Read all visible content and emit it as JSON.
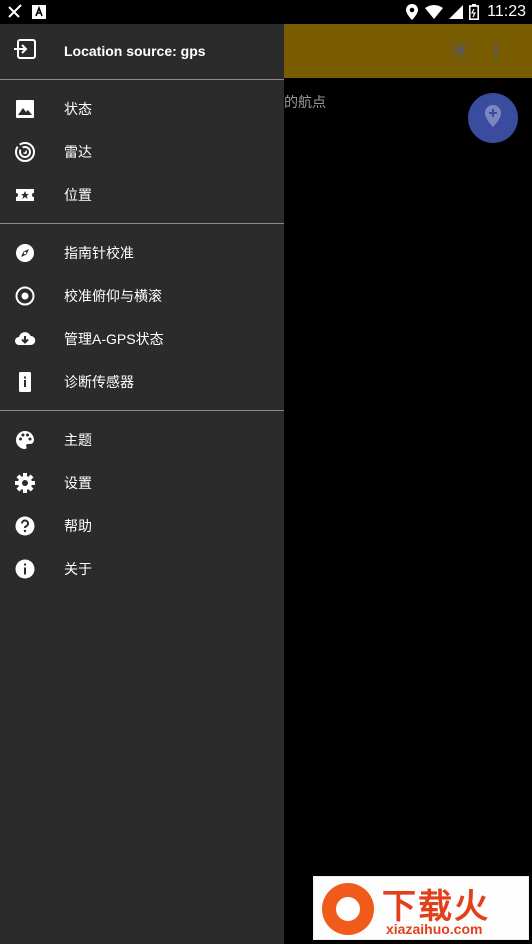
{
  "status_bar": {
    "time": "11:23",
    "icons": [
      "missed-call-icon",
      "notification-a-icon",
      "location-icon",
      "wifi-icon",
      "signal-icon",
      "battery-icon"
    ]
  },
  "background": {
    "hint_text": "的航点",
    "toolbar_icons": [
      "select-area-icon",
      "more-vert-icon"
    ],
    "toolbar_color": "#7a5c00",
    "fab_color": "#3a4c9e"
  },
  "drawer": {
    "header_label": "Location source: gps",
    "groups": [
      [
        {
          "label": "状态",
          "icon": "image-icon"
        },
        {
          "label": "雷达",
          "icon": "radar-icon"
        },
        {
          "label": "位置",
          "icon": "ticket-icon"
        }
      ],
      [
        {
          "label": "指南针校准",
          "icon": "compass-icon"
        },
        {
          "label": "校准俯仰与横滚",
          "icon": "target-icon"
        },
        {
          "label": "管理A-GPS状态",
          "icon": "cloud-download-icon"
        },
        {
          "label": "诊断传感器",
          "icon": "device-info-icon"
        }
      ],
      [
        {
          "label": "主题",
          "icon": "palette-icon"
        },
        {
          "label": "设置",
          "icon": "gear-icon"
        },
        {
          "label": "帮助",
          "icon": "help-icon"
        },
        {
          "label": "关于",
          "icon": "info-icon"
        }
      ]
    ]
  },
  "watermark": {
    "title": "下载火",
    "url": "xiazaihuo.com"
  }
}
